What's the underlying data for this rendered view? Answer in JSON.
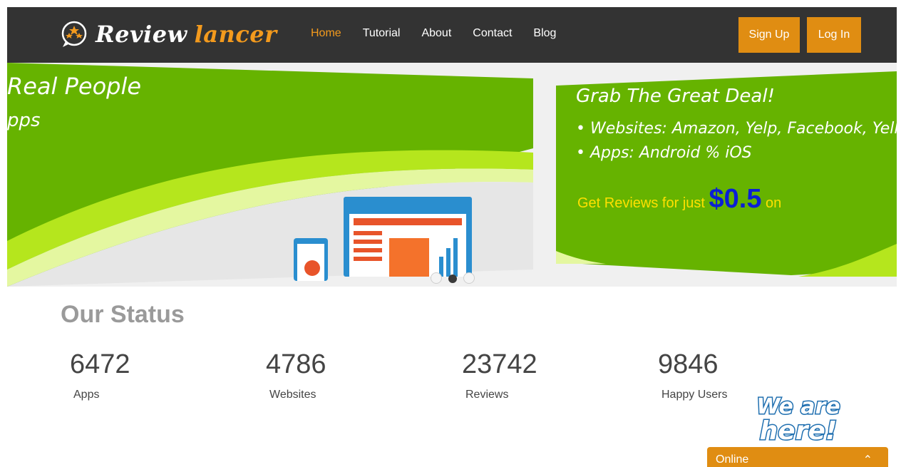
{
  "brand": {
    "name_part1": "Review",
    "name_part2": "lancer",
    "accent": "#f39a1d"
  },
  "nav": {
    "items": [
      {
        "label": "Home",
        "active": true
      },
      {
        "label": "Tutorial",
        "active": false
      },
      {
        "label": "About",
        "active": false
      },
      {
        "label": "Contact",
        "active": false
      },
      {
        "label": "Blog",
        "active": false
      }
    ],
    "signup_label": "Sign Up",
    "login_label": "Log In",
    "button_color": "#e08d12"
  },
  "banner": {
    "slide1": {
      "line1": "Real People",
      "line2": "pps"
    },
    "slide2": {
      "title": "Grab The Great Deal!",
      "bullet1": "• Websites: Amazon, Yelp, Facebook, Yellov",
      "bullet2": "• Apps: Android % iOS",
      "offer_prefix": "Get Reviews for just ",
      "offer_price": "$0.5",
      "offer_suffix": " on"
    },
    "slide_count": 3,
    "active_slide": 2,
    "green": "#66b300"
  },
  "status": {
    "title": "Our Status",
    "stats": [
      {
        "value": "6472",
        "label": "Apps"
      },
      {
        "value": "4786",
        "label": "Websites"
      },
      {
        "value": "23742",
        "label": "Reviews"
      },
      {
        "value": "9846",
        "label": "Happy Users"
      }
    ]
  },
  "chat": {
    "badge_text": "We are here!",
    "bar_label": "Online",
    "chevron_icon": "chevron-up-icon"
  }
}
